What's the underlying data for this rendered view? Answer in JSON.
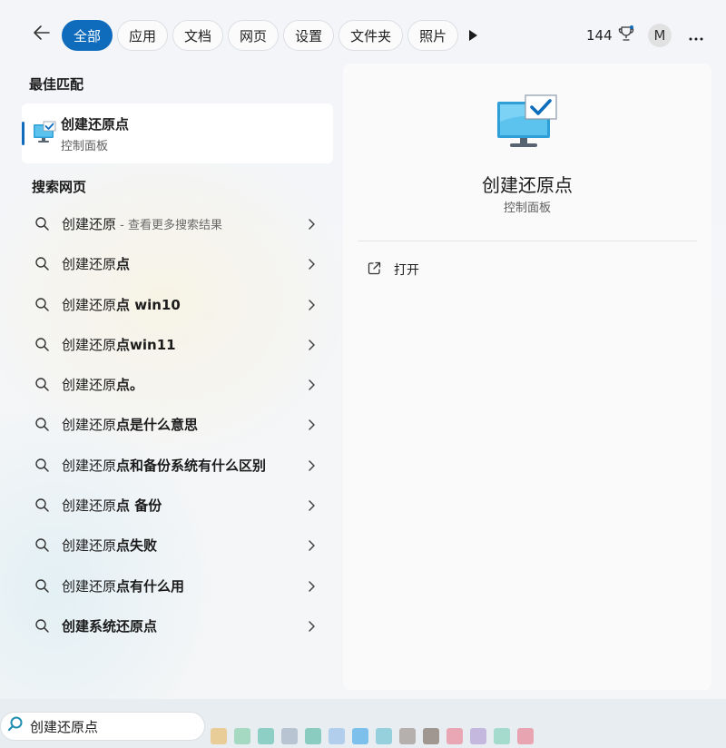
{
  "header": {
    "tabs": [
      {
        "label": "全部",
        "active": true
      },
      {
        "label": "应用",
        "active": false
      },
      {
        "label": "文档",
        "active": false
      },
      {
        "label": "网页",
        "active": false
      },
      {
        "label": "设置",
        "active": false
      },
      {
        "label": "文件夹",
        "active": false
      },
      {
        "label": "照片",
        "active": false
      }
    ],
    "play_icon": "play-icon",
    "reward_points": "144",
    "reward_icon": "trophy-icon",
    "avatar_initial": "M",
    "more_icon": "more-icon",
    "back_icon": "back-arrow-icon"
  },
  "best_match": {
    "section_title": "最佳匹配",
    "app_name": "创建还原点",
    "app_type": "控制面板",
    "icon": "monitor-check-icon"
  },
  "web_search": {
    "section_title": "搜索网页",
    "results": [
      {
        "query": "创建还原",
        "bold": "",
        "hint": " - 查看更多搜索结果"
      },
      {
        "query": "创建还原",
        "bold": "点",
        "hint": ""
      },
      {
        "query": "创建还原",
        "bold": "点 win10",
        "hint": ""
      },
      {
        "query": "创建还原",
        "bold": "点win11",
        "hint": ""
      },
      {
        "query": "创建还原",
        "bold": "点。",
        "hint": ""
      },
      {
        "query": "创建还原",
        "bold": "点是什么意思",
        "hint": ""
      },
      {
        "query": "创建还原",
        "bold": "点和备份系统有什么区别",
        "hint": ""
      },
      {
        "query": "创建还原",
        "bold": "点 备份",
        "hint": ""
      },
      {
        "query": "创建还原",
        "bold": "点失败",
        "hint": ""
      },
      {
        "query": "创建还原",
        "bold": "点有什么用",
        "hint": ""
      },
      {
        "query": "",
        "bold": "创建系统还原点",
        "hint": ""
      }
    ]
  },
  "preview": {
    "title": "创建还原点",
    "subtitle": "控制面板",
    "open_label": "打开",
    "open_icon": "open-external-icon"
  },
  "taskbar": {
    "search_value": "创建还原点",
    "search_icon": "search-icon",
    "app_colors": [
      "#e8c27a",
      "#8fd1b0",
      "#6fc4b5",
      "#a9b6c8",
      "#6cc0b0",
      "#9fc3ea",
      "#5ab0e8",
      "#7cc6d6",
      "#a49b95",
      "#8a7a70",
      "#ea8fa0",
      "#b8a6d8",
      "#8fd4c0",
      "#e88b9a"
    ]
  },
  "colors": {
    "accent": "#0f6cbd",
    "panel_bg": "#f3f5f8",
    "preview_bg": "#fafafa"
  }
}
